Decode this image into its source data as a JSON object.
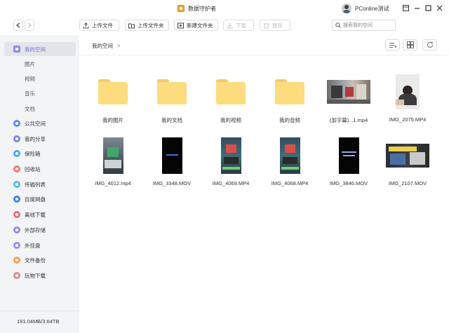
{
  "app": {
    "title": "数据守护者",
    "user": "PConline测试",
    "colors": {
      "accent": "#6c73d9",
      "folder": "#fcdc7d",
      "sidebar_bg": "#f3f4f6"
    }
  },
  "window_controls": {
    "close_to_tray": "☐",
    "minimize": "—",
    "maximize": "☐",
    "close": "✕"
  },
  "toolbar": {
    "back": "<",
    "forward": ">",
    "upload_file": "上传文件",
    "upload_folder": "上传文件夹",
    "new_folder": "新建文件夹",
    "download": "下载",
    "delete": "删除",
    "search_placeholder": "搜索我的空间"
  },
  "sidebar": {
    "items": [
      {
        "label": "我的空间",
        "icon": "my-space-icon",
        "active": true
      },
      {
        "label": "图片",
        "sub": true
      },
      {
        "label": "视频",
        "sub": true
      },
      {
        "label": "音乐",
        "sub": true
      },
      {
        "label": "文档",
        "sub": true
      },
      {
        "label": "公共空间",
        "icon": "public-space-icon"
      },
      {
        "label": "我的分享",
        "icon": "share-icon"
      },
      {
        "label": "保险箱",
        "icon": "safe-icon"
      },
      {
        "label": "回收站",
        "icon": "recycle-bin-icon"
      },
      {
        "label": "传输列表",
        "icon": "transfer-list-icon"
      },
      {
        "label": "百度网盘",
        "icon": "baidu-netdisk-icon"
      },
      {
        "label": "离线下载",
        "icon": "offline-download-icon"
      },
      {
        "label": "外部存储",
        "icon": "external-storage-icon"
      },
      {
        "label": "外挂盘",
        "icon": "mounted-disk-icon"
      },
      {
        "label": "文件备份",
        "icon": "file-backup-icon"
      },
      {
        "label": "玩物下载",
        "icon": "wanwu-download-icon"
      }
    ],
    "storage": "191.04MB/3.64TB"
  },
  "main": {
    "breadcrumb": "我的空间",
    "breadcrumb_arrow": ">",
    "files": [
      {
        "name": "我的图片",
        "type": "folder"
      },
      {
        "name": "我的文档",
        "type": "folder"
      },
      {
        "name": "我的视频",
        "type": "folder"
      },
      {
        "name": "我的音频",
        "type": "folder"
      },
      {
        "name": "(加字幕)...1.mp4",
        "type": "video-landscape"
      },
      {
        "name": "IMG_2075.MP4",
        "type": "video-square"
      },
      {
        "name": "IMG_4012.mp4",
        "type": "video-portrait"
      },
      {
        "name": "IMG_3348.MOV",
        "type": "video-portrait"
      },
      {
        "name": "IMG_4069.MP4",
        "type": "video-portrait"
      },
      {
        "name": "IMG_4068.MP4",
        "type": "video-portrait"
      },
      {
        "name": "IMG_3846.MOV",
        "type": "video-portrait"
      },
      {
        "name": "IMG_2107.MOV",
        "type": "video-landscape"
      }
    ]
  }
}
